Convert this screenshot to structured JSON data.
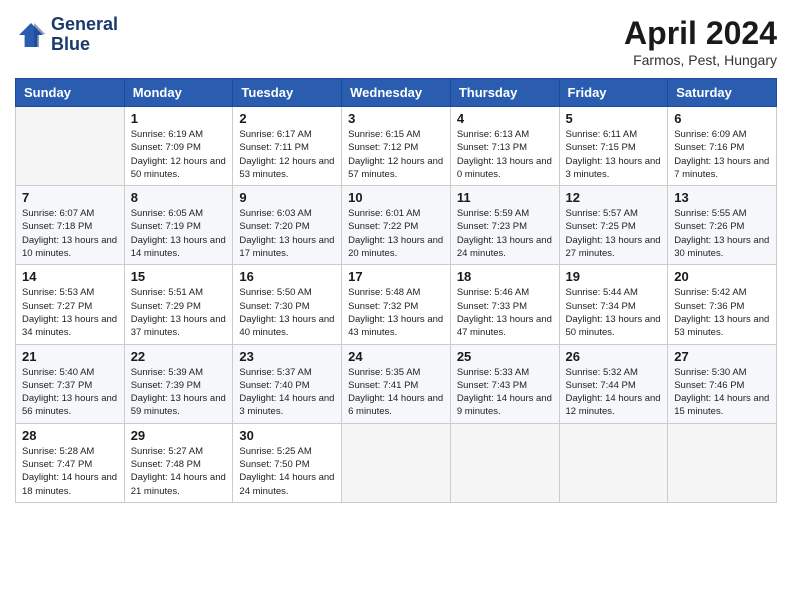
{
  "header": {
    "logo_line1": "General",
    "logo_line2": "Blue",
    "title": "April 2024",
    "subtitle": "Farmos, Pest, Hungary"
  },
  "weekdays": [
    "Sunday",
    "Monday",
    "Tuesday",
    "Wednesday",
    "Thursday",
    "Friday",
    "Saturday"
  ],
  "weeks": [
    [
      {
        "day": "",
        "sunrise": "",
        "sunset": "",
        "daylight": ""
      },
      {
        "day": "1",
        "sunrise": "Sunrise: 6:19 AM",
        "sunset": "Sunset: 7:09 PM",
        "daylight": "Daylight: 12 hours and 50 minutes."
      },
      {
        "day": "2",
        "sunrise": "Sunrise: 6:17 AM",
        "sunset": "Sunset: 7:11 PM",
        "daylight": "Daylight: 12 hours and 53 minutes."
      },
      {
        "day": "3",
        "sunrise": "Sunrise: 6:15 AM",
        "sunset": "Sunset: 7:12 PM",
        "daylight": "Daylight: 12 hours and 57 minutes."
      },
      {
        "day": "4",
        "sunrise": "Sunrise: 6:13 AM",
        "sunset": "Sunset: 7:13 PM",
        "daylight": "Daylight: 13 hours and 0 minutes."
      },
      {
        "day": "5",
        "sunrise": "Sunrise: 6:11 AM",
        "sunset": "Sunset: 7:15 PM",
        "daylight": "Daylight: 13 hours and 3 minutes."
      },
      {
        "day": "6",
        "sunrise": "Sunrise: 6:09 AM",
        "sunset": "Sunset: 7:16 PM",
        "daylight": "Daylight: 13 hours and 7 minutes."
      }
    ],
    [
      {
        "day": "7",
        "sunrise": "Sunrise: 6:07 AM",
        "sunset": "Sunset: 7:18 PM",
        "daylight": "Daylight: 13 hours and 10 minutes."
      },
      {
        "day": "8",
        "sunrise": "Sunrise: 6:05 AM",
        "sunset": "Sunset: 7:19 PM",
        "daylight": "Daylight: 13 hours and 14 minutes."
      },
      {
        "day": "9",
        "sunrise": "Sunrise: 6:03 AM",
        "sunset": "Sunset: 7:20 PM",
        "daylight": "Daylight: 13 hours and 17 minutes."
      },
      {
        "day": "10",
        "sunrise": "Sunrise: 6:01 AM",
        "sunset": "Sunset: 7:22 PM",
        "daylight": "Daylight: 13 hours and 20 minutes."
      },
      {
        "day": "11",
        "sunrise": "Sunrise: 5:59 AM",
        "sunset": "Sunset: 7:23 PM",
        "daylight": "Daylight: 13 hours and 24 minutes."
      },
      {
        "day": "12",
        "sunrise": "Sunrise: 5:57 AM",
        "sunset": "Sunset: 7:25 PM",
        "daylight": "Daylight: 13 hours and 27 minutes."
      },
      {
        "day": "13",
        "sunrise": "Sunrise: 5:55 AM",
        "sunset": "Sunset: 7:26 PM",
        "daylight": "Daylight: 13 hours and 30 minutes."
      }
    ],
    [
      {
        "day": "14",
        "sunrise": "Sunrise: 5:53 AM",
        "sunset": "Sunset: 7:27 PM",
        "daylight": "Daylight: 13 hours and 34 minutes."
      },
      {
        "day": "15",
        "sunrise": "Sunrise: 5:51 AM",
        "sunset": "Sunset: 7:29 PM",
        "daylight": "Daylight: 13 hours and 37 minutes."
      },
      {
        "day": "16",
        "sunrise": "Sunrise: 5:50 AM",
        "sunset": "Sunset: 7:30 PM",
        "daylight": "Daylight: 13 hours and 40 minutes."
      },
      {
        "day": "17",
        "sunrise": "Sunrise: 5:48 AM",
        "sunset": "Sunset: 7:32 PM",
        "daylight": "Daylight: 13 hours and 43 minutes."
      },
      {
        "day": "18",
        "sunrise": "Sunrise: 5:46 AM",
        "sunset": "Sunset: 7:33 PM",
        "daylight": "Daylight: 13 hours and 47 minutes."
      },
      {
        "day": "19",
        "sunrise": "Sunrise: 5:44 AM",
        "sunset": "Sunset: 7:34 PM",
        "daylight": "Daylight: 13 hours and 50 minutes."
      },
      {
        "day": "20",
        "sunrise": "Sunrise: 5:42 AM",
        "sunset": "Sunset: 7:36 PM",
        "daylight": "Daylight: 13 hours and 53 minutes."
      }
    ],
    [
      {
        "day": "21",
        "sunrise": "Sunrise: 5:40 AM",
        "sunset": "Sunset: 7:37 PM",
        "daylight": "Daylight: 13 hours and 56 minutes."
      },
      {
        "day": "22",
        "sunrise": "Sunrise: 5:39 AM",
        "sunset": "Sunset: 7:39 PM",
        "daylight": "Daylight: 13 hours and 59 minutes."
      },
      {
        "day": "23",
        "sunrise": "Sunrise: 5:37 AM",
        "sunset": "Sunset: 7:40 PM",
        "daylight": "Daylight: 14 hours and 3 minutes."
      },
      {
        "day": "24",
        "sunrise": "Sunrise: 5:35 AM",
        "sunset": "Sunset: 7:41 PM",
        "daylight": "Daylight: 14 hours and 6 minutes."
      },
      {
        "day": "25",
        "sunrise": "Sunrise: 5:33 AM",
        "sunset": "Sunset: 7:43 PM",
        "daylight": "Daylight: 14 hours and 9 minutes."
      },
      {
        "day": "26",
        "sunrise": "Sunrise: 5:32 AM",
        "sunset": "Sunset: 7:44 PM",
        "daylight": "Daylight: 14 hours and 12 minutes."
      },
      {
        "day": "27",
        "sunrise": "Sunrise: 5:30 AM",
        "sunset": "Sunset: 7:46 PM",
        "daylight": "Daylight: 14 hours and 15 minutes."
      }
    ],
    [
      {
        "day": "28",
        "sunrise": "Sunrise: 5:28 AM",
        "sunset": "Sunset: 7:47 PM",
        "daylight": "Daylight: 14 hours and 18 minutes."
      },
      {
        "day": "29",
        "sunrise": "Sunrise: 5:27 AM",
        "sunset": "Sunset: 7:48 PM",
        "daylight": "Daylight: 14 hours and 21 minutes."
      },
      {
        "day": "30",
        "sunrise": "Sunrise: 5:25 AM",
        "sunset": "Sunset: 7:50 PM",
        "daylight": "Daylight: 14 hours and 24 minutes."
      },
      {
        "day": "",
        "sunrise": "",
        "sunset": "",
        "daylight": ""
      },
      {
        "day": "",
        "sunrise": "",
        "sunset": "",
        "daylight": ""
      },
      {
        "day": "",
        "sunrise": "",
        "sunset": "",
        "daylight": ""
      },
      {
        "day": "",
        "sunrise": "",
        "sunset": "",
        "daylight": ""
      }
    ]
  ]
}
